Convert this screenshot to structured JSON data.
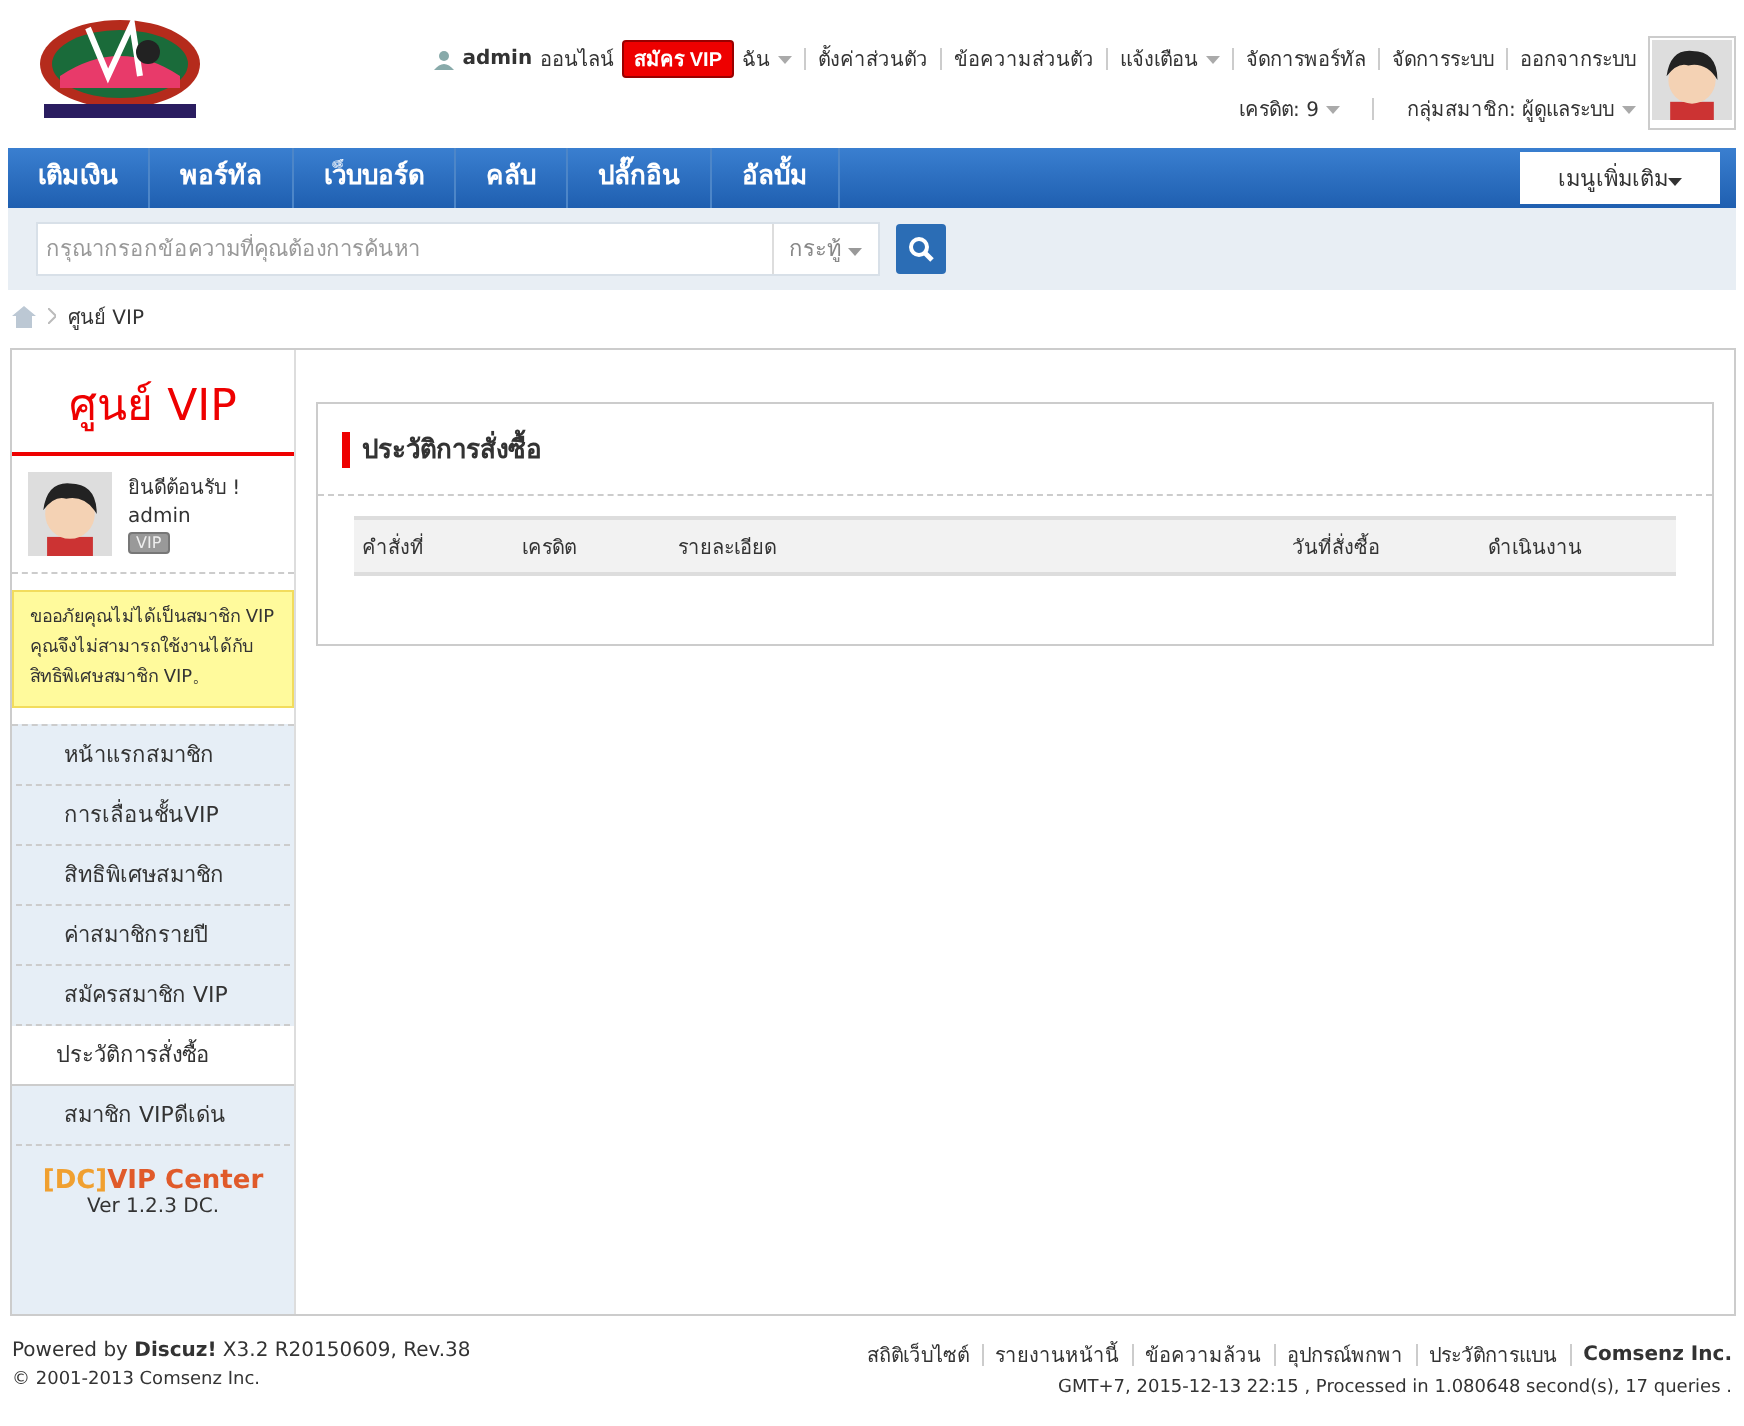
{
  "user_bar": {
    "username": "admin",
    "status": "ออนไลน์",
    "vip_button": "สมัคร VIP",
    "links": [
      {
        "label": "ฉัน",
        "dropdown": true
      },
      {
        "label": "ตั้งค่าส่วนตัว",
        "dropdown": false
      },
      {
        "label": "ข้อความส่วนตัว",
        "dropdown": false
      },
      {
        "label": "แจ้งเตือน",
        "dropdown": true
      },
      {
        "label": "จัดการพอร์ทัล",
        "dropdown": false
      },
      {
        "label": "จัดการระบบ",
        "dropdown": false
      },
      {
        "label": "ออกจากระบบ",
        "dropdown": false
      }
    ],
    "credit": "เครดิต: 9",
    "group": "กลุ่มสมาชิก: ผู้ดูแลระบบ"
  },
  "nav": {
    "items": [
      "เติมเงิน",
      "พอร์ทัล",
      "เว็บบอร์ด",
      "คลับ",
      "ปลั๊กอิน",
      "อัลบั้ม"
    ],
    "more": "เมนูเพิ่มเติม"
  },
  "search": {
    "placeholder": "กรุณากรอกข้อความที่คุณต้องการค้นหา",
    "scope": "กระทู้"
  },
  "breadcrumb": [
    "ศูนย์ VIP"
  ],
  "sidebar": {
    "title": "ศูนย์ VIP",
    "welcome": "ยินดีต้อนรับ !",
    "username": "admin",
    "badge": "VIP",
    "notice": "ขออภัยคุณไม่ได้เป็นสมาชิก VIP คุณจึงไม่สามารถใช้งานได้กับสิทธิพิเศษสมาชิก VIP。",
    "items": [
      {
        "label": "หน้าแรกสมาชิก",
        "selected": false
      },
      {
        "label": "การเลื่อนชั้นVIP",
        "selected": false
      },
      {
        "label": "สิทธิพิเศษสมาชิก",
        "selected": false
      },
      {
        "label": "ค่าสมาชิกรายปี",
        "selected": false
      },
      {
        "label": "สมัครสมาชิก VIP",
        "selected": false
      },
      {
        "label": "ประวัติการสั่งซื้อ",
        "selected": true
      },
      {
        "label": "สมาชิก VIPดีเด่น",
        "selected": false
      }
    ],
    "brand_prefix": "[DC]",
    "brand": "VIP Center",
    "version": "Ver 1.2.3 DC."
  },
  "panel": {
    "title": "ประวัติการสั่งซื้อ",
    "columns": [
      "คำสั่งที่",
      "เครดิต",
      "รายละเอียด",
      "วันที่สั่งซื้อ",
      "ดำเนินงาน"
    ]
  },
  "footer": {
    "powered": "Powered by **Discuz!** X3.2 R20150609, Rev.38",
    "copyright": "© 2001-2013 Comsenz Inc.",
    "links": [
      "สถิติเว็บไซต์",
      "รายงานหน้านี้",
      "ข้อความล้วน",
      "อุปกรณ์พกพา",
      "ประวัติการแบน"
    ],
    "company": "Comsenz Inc.",
    "stats": "GMT+7, 2015-12-13 22:15 , Processed in 1.080648 second(s), 17 queries ."
  }
}
